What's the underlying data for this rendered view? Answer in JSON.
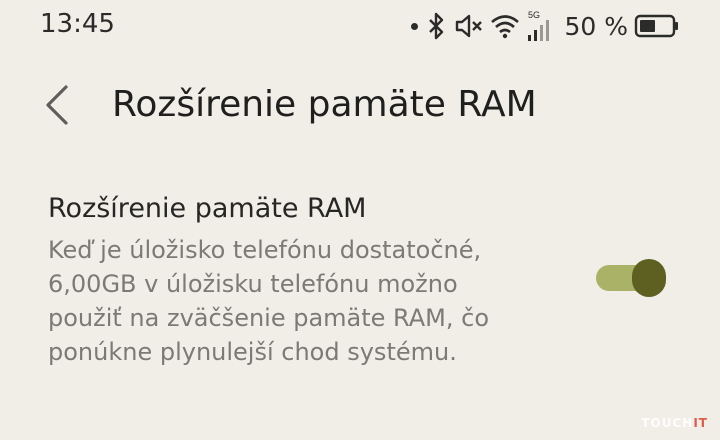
{
  "status_bar": {
    "time": "13:45",
    "network_label": "5G",
    "battery_percent": "50 %",
    "battery_level": 0.5,
    "icons": [
      "notification-dot-icon",
      "bluetooth-icon",
      "mute-icon",
      "wifi-icon",
      "signal-icon",
      "battery-icon"
    ]
  },
  "header": {
    "back_icon": "chevron-left-icon",
    "title": "Rozšírenie pamäte RAM"
  },
  "setting": {
    "title": "Rozšírenie pamäte RAM",
    "description": "Keď je úložisko telefónu dostatočné,\n6,00GB v úložisku telefónu možno\npoužiť na zväčšenie pamäte RAM, čo\nponúkne plynulejší chod systému.",
    "toggle_state": "on"
  },
  "colors": {
    "background": "#f1eee8",
    "toggle_track": "#aab268",
    "toggle_thumb": "#5d6021",
    "description_text": "#7c7a75"
  },
  "watermark": {
    "text_a": "TOUCH",
    "text_b": "IT"
  }
}
